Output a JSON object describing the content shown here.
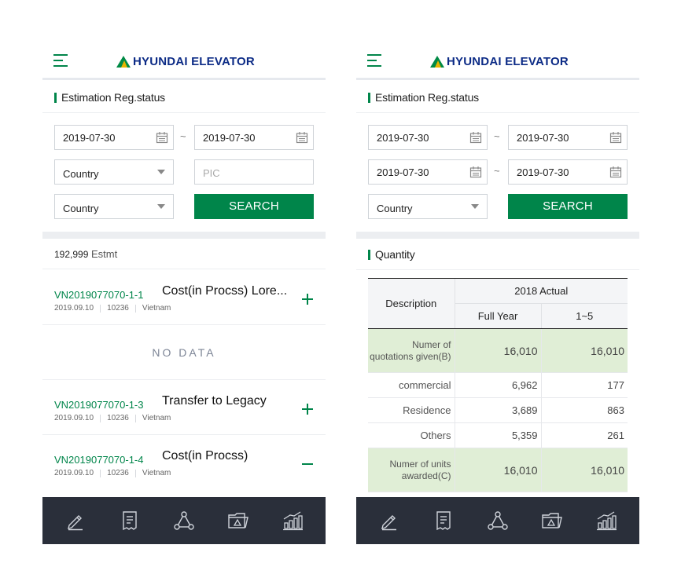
{
  "brand": {
    "name": "HYUNDAI ELEVATOR"
  },
  "left": {
    "section_title": "Estimation Reg.status",
    "date_from": "2019-07-30",
    "date_to": "2019-07-30",
    "tilde": "~",
    "country_select_1": "Country",
    "pic_placeholder": "PIC",
    "country_select_2": "Country",
    "search_label": "SEARCH",
    "count_number": "192,999",
    "count_unit": "Estmt",
    "items": [
      {
        "code": "VN2019077070-1-1",
        "title": "Cost(in Procss) Lore...",
        "date": "2019.09.10",
        "num": "10236",
        "country": "Vietnam"
      },
      {
        "code": "VN2019077070-1-3",
        "title": "Transfer to Legacy",
        "date": "2019.09.10",
        "num": "10236",
        "country": "Vietnam"
      },
      {
        "code": "VN2019077070-1-4",
        "title": "Cost(in Procss)",
        "date": "2019.09.10",
        "num": "10236",
        "country": "Vietnam"
      }
    ],
    "no_data": "NO DATA"
  },
  "right": {
    "section_title": "Estimation Reg.status",
    "row1_from": "2019-07-30",
    "row1_to": "2019-07-30",
    "row2_from": "2019-07-30",
    "row2_to": "2019-07-30",
    "tilde": "~",
    "country_select": "Country",
    "search_label": "SEARCH",
    "quantity_title": "Quantity",
    "table": {
      "col_desc": "Description",
      "col_group": "2018 Actual",
      "col_full_year": "Full Year",
      "col_range": "1~5",
      "rows": [
        {
          "desc": "Numer of quotations given(B)",
          "full": "16,010",
          "range": "16,010"
        },
        {
          "desc": "commercial",
          "full": "6,962",
          "range": "177"
        },
        {
          "desc": "Residence",
          "full": "3,689",
          "range": "863"
        },
        {
          "desc": "Others",
          "full": "5,359",
          "range": "261"
        },
        {
          "desc": "Numer of units awarded(C)",
          "full": "16,010",
          "range": "16,010"
        }
      ]
    }
  },
  "nav_icons": [
    "pencil-icon",
    "receipt-icon",
    "network-icon",
    "folder-chart-icon",
    "bar-chart-icon"
  ],
  "colors": {
    "accent": "#00854a",
    "brand_blue": "#0c2b86",
    "nav_bg": "#2a2f3a",
    "highlight_row": "#e0eed6"
  }
}
